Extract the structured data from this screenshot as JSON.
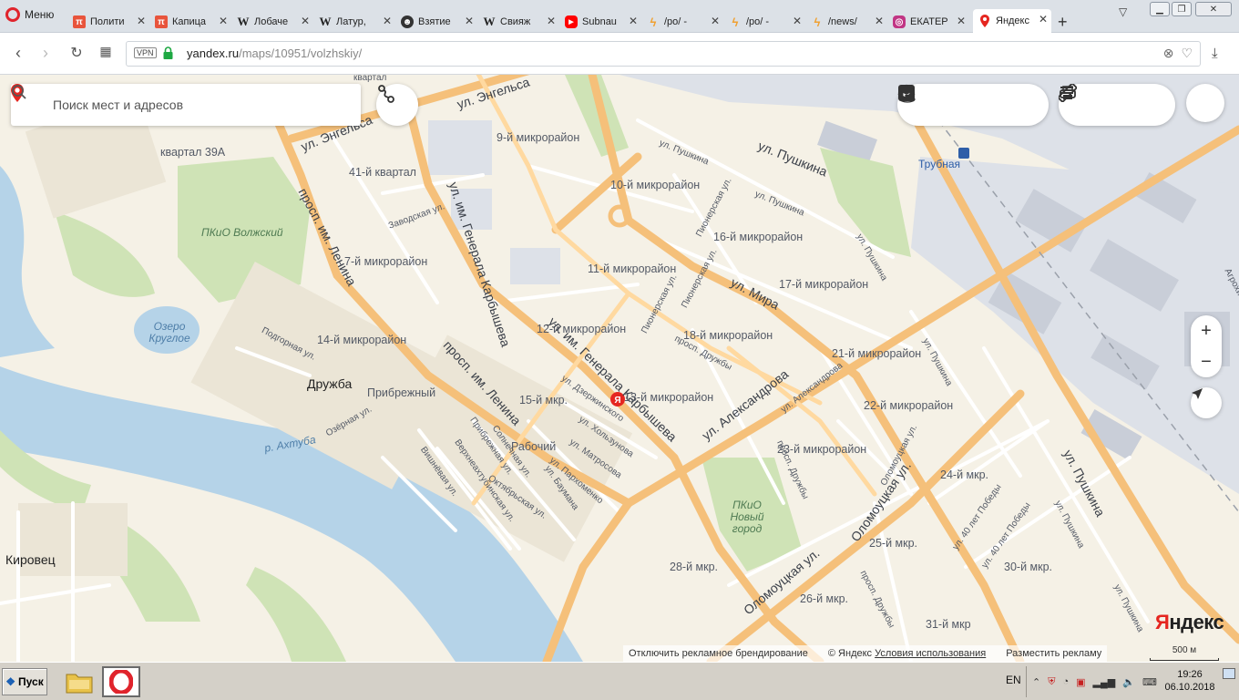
{
  "browser": {
    "menu_label": "Меню",
    "tabs": [
      {
        "label": "Полити",
        "icon": "pi-icon",
        "color": "#e8543c"
      },
      {
        "label": "Капица",
        "icon": "pi-icon",
        "color": "#e8543c"
      },
      {
        "label": "Лобаче",
        "icon": "wikipedia-icon",
        "color": "#222222"
      },
      {
        "label": "Латур,",
        "icon": "wikipedia-icon",
        "color": "#222222"
      },
      {
        "label": "Взятие",
        "icon": "face-icon",
        "color": "#333333"
      },
      {
        "label": "Свияж",
        "icon": "wikipedia-icon",
        "color": "#222222"
      },
      {
        "label": "Subnau",
        "icon": "youtube-icon",
        "color": "#ff0000"
      },
      {
        "label": "/po/ - ",
        "icon": "lightning-icon",
        "color": "#f0a030"
      },
      {
        "label": "/po/ - ",
        "icon": "lightning-icon",
        "color": "#f0a030"
      },
      {
        "label": "/news/",
        "icon": "lightning-icon",
        "color": "#f0a030"
      },
      {
        "label": "ЕКАТЕР",
        "icon": "instagram-icon",
        "color": "#c13584"
      },
      {
        "label": "Яндекс",
        "icon": "map-pin-icon",
        "color": "#e52620",
        "active": true
      }
    ],
    "url_domain": "yandex.ru",
    "url_path": "/maps/10951/volzhskiy/",
    "vpn_label": "VPN"
  },
  "map": {
    "search_placeholder": "Поиск мест и адресов",
    "labels": [
      {
        "text": "ул. Энгельса",
        "kind": "road"
      },
      {
        "text": "ул. Энгельса",
        "kind": "road"
      },
      {
        "text": "квартал 39А",
        "kind": "district"
      },
      {
        "text": "9-й микрорайон",
        "kind": "district"
      },
      {
        "text": "41-й квартал",
        "kind": "district"
      },
      {
        "text": "ПКиО Волжский",
        "kind": "park"
      },
      {
        "text": "Заводская ул.",
        "kind": "street"
      },
      {
        "text": "просп. им. Ленина",
        "kind": "road"
      },
      {
        "text": "ул. им. Генерала Карбышева",
        "kind": "road"
      },
      {
        "text": "10-й микрорайон",
        "kind": "district"
      },
      {
        "text": "ул. Пушкина",
        "kind": "road"
      },
      {
        "text": "ул. Пушкина",
        "kind": "street"
      },
      {
        "text": "ул. Пушкина",
        "kind": "street"
      },
      {
        "text": "ул. Пушкина",
        "kind": "street"
      },
      {
        "text": "Трубная",
        "kind": "poi"
      },
      {
        "text": "7-й микрорайон",
        "kind": "district"
      },
      {
        "text": "11-й микрорайон",
        "kind": "district"
      },
      {
        "text": "16-й микрорайон",
        "kind": "district"
      },
      {
        "text": "Пионерская ул.",
        "kind": "street"
      },
      {
        "text": "Пионерская ул.",
        "kind": "street"
      },
      {
        "text": "Пионерская ул.",
        "kind": "street"
      },
      {
        "text": "ул. Мира",
        "kind": "road"
      },
      {
        "text": "17-й микрорайон",
        "kind": "district"
      },
      {
        "text": "Озеро Круглое",
        "kind": "water"
      },
      {
        "text": "14-й микрорайон",
        "kind": "district"
      },
      {
        "text": "12-й микрорайон",
        "kind": "district"
      },
      {
        "text": "18-й микрорайон",
        "kind": "district"
      },
      {
        "text": "21-й микрорайон",
        "kind": "district"
      },
      {
        "text": "Подгорная ул.",
        "kind": "street"
      },
      {
        "text": "просп. Дружбы",
        "kind": "street"
      },
      {
        "text": "ул. Александрова",
        "kind": "road"
      },
      {
        "text": "просп. им. Ленина",
        "kind": "road"
      },
      {
        "text": "ул. им. Генерала Карбышева",
        "kind": "road"
      },
      {
        "text": "Дружба",
        "kind": "city"
      },
      {
        "text": "Прибрежный",
        "kind": "district"
      },
      {
        "text": "15-й мкр.",
        "kind": "district"
      },
      {
        "text": "13-й микрорайон",
        "kind": "district"
      },
      {
        "text": "ул. Александрова",
        "kind": "street"
      },
      {
        "text": "22-й микрорайон",
        "kind": "district"
      },
      {
        "text": "Озёрная ул.",
        "kind": "street"
      },
      {
        "text": "ул. Дзержинского",
        "kind": "street"
      },
      {
        "text": "ул. Хользунова",
        "kind": "street"
      },
      {
        "text": "р. Ахтуба",
        "kind": "water"
      },
      {
        "text": "Рабочий",
        "kind": "district"
      },
      {
        "text": "ул. Матросова",
        "kind": "street"
      },
      {
        "text": "23-й микрорайон",
        "kind": "district"
      },
      {
        "text": "Прибрежная ул.",
        "kind": "street"
      },
      {
        "text": "Солнечная ул.",
        "kind": "street"
      },
      {
        "text": "ул. Пархоменко",
        "kind": "street"
      },
      {
        "text": "Вишнёвая ул.",
        "kind": "street"
      },
      {
        "text": "Верхнеахтубинская ул.",
        "kind": "street"
      },
      {
        "text": "ул. Баумана",
        "kind": "street"
      },
      {
        "text": "Октябрьская ул.",
        "kind": "street"
      },
      {
        "text": "просп. Дружбы",
        "kind": "street"
      },
      {
        "text": "Оломоуцкая ул.",
        "kind": "street"
      },
      {
        "text": "Оломоуцкая ул.",
        "kind": "road"
      },
      {
        "text": "24-й мкр.",
        "kind": "district"
      },
      {
        "text": "ПКиО Новый город",
        "kind": "park"
      },
      {
        "text": "ул. Пушкина",
        "kind": "road"
      },
      {
        "text": "ул. Пушкина",
        "kind": "street"
      },
      {
        "text": "ул. 40 лет Победы",
        "kind": "street"
      },
      {
        "text": "ул. 40 лет Победы",
        "kind": "street"
      },
      {
        "text": "ул. Пушкина",
        "kind": "street"
      },
      {
        "text": "25-й мкр.",
        "kind": "district"
      },
      {
        "text": "Кировец",
        "kind": "city"
      },
      {
        "text": "28-й мкр.",
        "kind": "district"
      },
      {
        "text": "30-й мкр.",
        "kind": "district"
      },
      {
        "text": "Оломоуцкая ул.",
        "kind": "road"
      },
      {
        "text": "26-й мкр.",
        "kind": "district"
      },
      {
        "text": "просп. Дружбы",
        "kind": "street"
      },
      {
        "text": "ул. Пушкина",
        "kind": "street"
      },
      {
        "text": "31-й мкр",
        "kind": "district"
      },
      {
        "text": "квартал",
        "kind": "district"
      },
      {
        "text": "Агрохи",
        "kind": "street"
      }
    ],
    "logo": "Яндекс",
    "logo_first": "Я",
    "logo_rest": "ндекс",
    "attribution": {
      "disable_branding": "Отключить рекламное брендирование",
      "copyright": "© Яндекс",
      "terms": "Условия использования",
      "ads": "Разместить рекламу"
    },
    "scale_label": "500 м",
    "zoom_in": "+",
    "zoom_out": "−",
    "colors": {
      "background": "#f5f1e6",
      "park": "#cfe3b6",
      "water": "#b5d3e8",
      "industrial": "#dde1e8",
      "major_road": "#f5c07a",
      "minor_road": "#ffffff",
      "accent_red": "#e52620"
    }
  },
  "taskbar": {
    "start_label": "Пуск",
    "lang": "EN",
    "time": "19:26",
    "date": "06.10.2018"
  }
}
